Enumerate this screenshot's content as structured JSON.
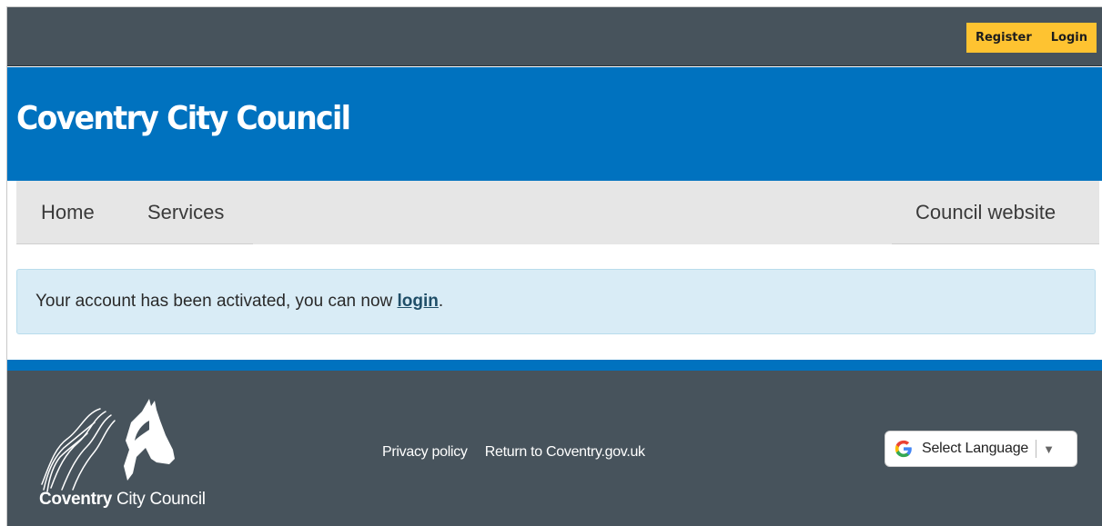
{
  "header": {
    "register_label": "Register",
    "login_label": "Login",
    "site_title": "Coventry City Council"
  },
  "nav": {
    "home_label": "Home",
    "services_label": "Services",
    "council_website_label": "Council website"
  },
  "alert": {
    "message_prefix": "Your account has been activated, you can now ",
    "link_label": "login",
    "message_suffix": "."
  },
  "footer": {
    "logo_bold": "Coventry",
    "logo_rest": " City Council",
    "privacy_label": "Privacy policy",
    "return_label": "Return to Coventry.gov.uk",
    "language_label": "Select Language",
    "language_arrow": "▼"
  },
  "colors": {
    "topbar": "#47535c",
    "brand_blue": "#0072bf",
    "auth_yellow": "#fec331",
    "alert_bg": "#d9ecf6",
    "nav_bg": "#e6e6e6"
  },
  "icons": [
    "google-g-icon",
    "dropdown-arrow-icon",
    "coventry-horse-logo"
  ]
}
